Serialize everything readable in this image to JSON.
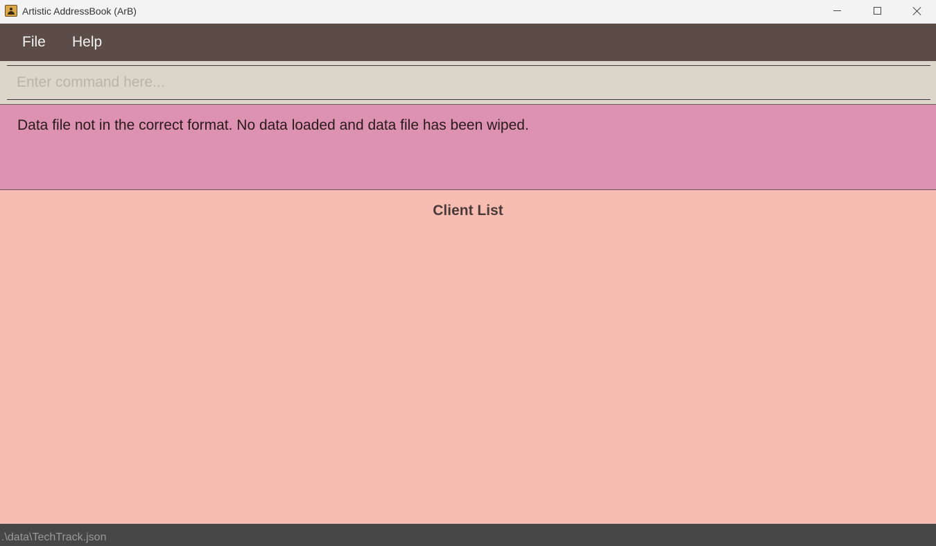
{
  "window": {
    "title": "Artistic AddressBook (ArB)",
    "icon": "address-book-icon"
  },
  "menu": {
    "items": [
      {
        "label": "File"
      },
      {
        "label": "Help"
      }
    ]
  },
  "command": {
    "value": "",
    "placeholder": "Enter command here..."
  },
  "result": {
    "message": "Data file not in the correct format. No data loaded and data file has been wiped."
  },
  "client_list": {
    "title": "Client List",
    "items": []
  },
  "status": {
    "path": ".\\data\\TechTrack.json"
  },
  "colors": {
    "menubar": "#5b4c48",
    "command_bg": "#dbd6c9",
    "result_bg": "#dc92b0",
    "list_bg": "#f7bdb2",
    "statusbar": "#474747"
  }
}
